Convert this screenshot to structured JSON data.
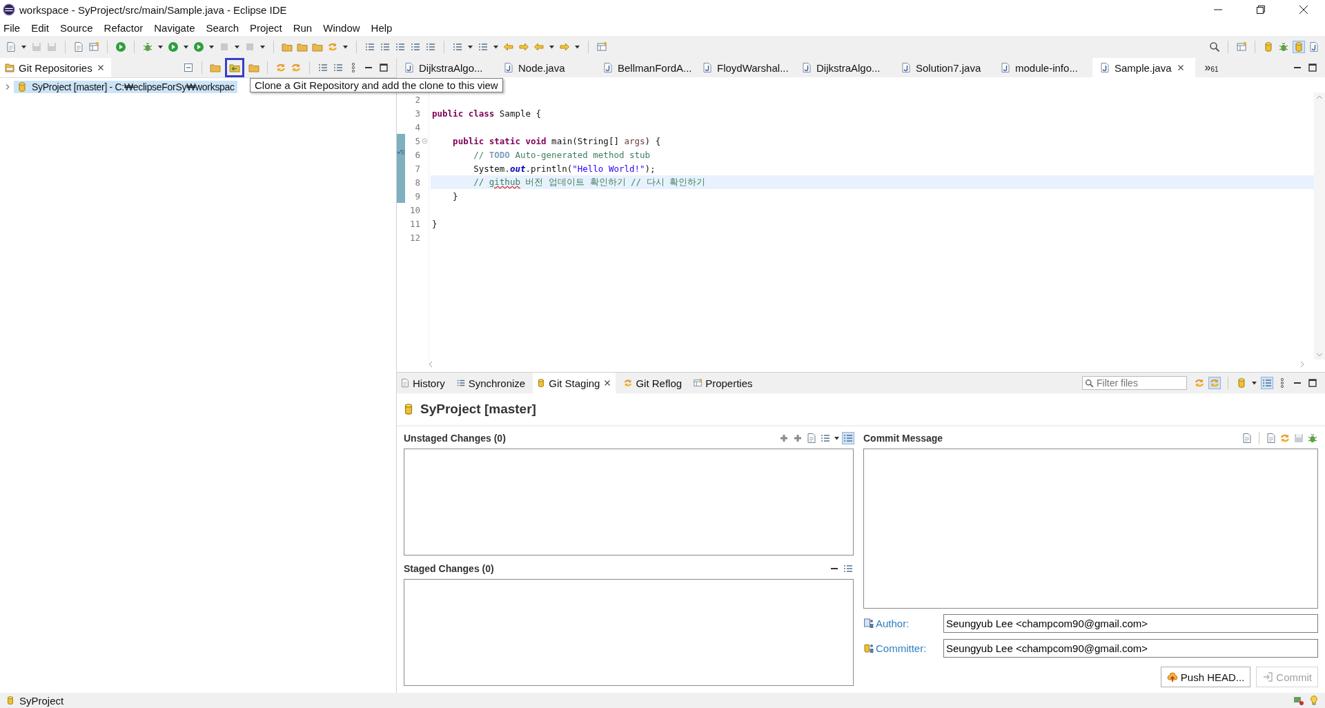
{
  "window": {
    "title": "workspace - SyProject/src/main/Sample.java - Eclipse IDE"
  },
  "menu": [
    "File",
    "Edit",
    "Source",
    "Refactor",
    "Navigate",
    "Search",
    "Project",
    "Run",
    "Window",
    "Help"
  ],
  "git_repositories": {
    "title": "Git Repositories",
    "tree": [
      {
        "label": "SyProject [master] - C:₩eclipseForSy₩workspac",
        "expanded": false,
        "selected": true
      }
    ],
    "tooltip": {
      "text": "Clone a Git Repository and add the clone to this view",
      "anchor_marked": true
    }
  },
  "editor": {
    "tabs": [
      {
        "label": "DijkstraAlgo...",
        "selected": false
      },
      {
        "label": "Node.java",
        "selected": false
      },
      {
        "label": "BellmanFordA...",
        "selected": false
      },
      {
        "label": "FloydWarshal...",
        "selected": false
      },
      {
        "label": "DijkstraAlgo...",
        "selected": false
      },
      {
        "label": "Solution7.java",
        "selected": false
      },
      {
        "label": "module-info...",
        "selected": false
      },
      {
        "label": "Sample.java",
        "selected": true
      }
    ],
    "overflow": {
      "symbol": "»",
      "count": "61"
    },
    "lines": [
      {
        "number": "2",
        "highlighted": false,
        "changed": false,
        "fold": false,
        "task": false
      },
      {
        "number": "3",
        "highlighted": false,
        "changed": false,
        "fold": false,
        "task": false,
        "tokens": [
          {
            "kind": "keyword",
            "text": "public class"
          },
          {
            "kind": "plain",
            "text": " Sample {"
          }
        ]
      },
      {
        "number": "4",
        "highlighted": false,
        "changed": false,
        "fold": false,
        "task": false
      },
      {
        "number": "5",
        "highlighted": false,
        "changed": true,
        "fold": true,
        "task": false,
        "tokens": [
          {
            "kind": "keyword",
            "text": "    public static void"
          },
          {
            "kind": "plain",
            "text": " main(String[] "
          },
          {
            "kind": "param",
            "text": "args"
          },
          {
            "kind": "plain",
            "text": ") {"
          }
        ]
      },
      {
        "number": "6",
        "highlighted": false,
        "changed": true,
        "fold": false,
        "task": true,
        "tokens": [
          {
            "kind": "comment",
            "text": "        // "
          },
          {
            "kind": "todo",
            "text": "TODO"
          },
          {
            "kind": "comment",
            "text": " Auto-generated method stub"
          }
        ]
      },
      {
        "number": "7",
        "highlighted": false,
        "changed": true,
        "fold": false,
        "task": false,
        "tokens": [
          {
            "kind": "plain",
            "text": "        System."
          },
          {
            "kind": "field",
            "text": "out"
          },
          {
            "kind": "plain",
            "text": ".println("
          },
          {
            "kind": "string",
            "text": "\"Hello World!\""
          },
          {
            "kind": "plain",
            "text": ");"
          }
        ]
      },
      {
        "number": "8",
        "highlighted": true,
        "changed": true,
        "fold": false,
        "task": false,
        "tokens": [
          {
            "kind": "comment",
            "text": "        // "
          },
          {
            "kind": "misspelled",
            "text": "github"
          },
          {
            "kind": "comment",
            "text": " 버전 업데이트 확인하기 // 다시 확인하기"
          }
        ]
      },
      {
        "number": "9",
        "highlighted": false,
        "changed": true,
        "fold": false,
        "task": false,
        "tokens": [
          {
            "kind": "plain",
            "text": "    }"
          }
        ]
      },
      {
        "number": "10",
        "highlighted": false,
        "changed": false,
        "fold": false,
        "task": false
      },
      {
        "number": "11",
        "highlighted": false,
        "changed": false,
        "fold": false,
        "task": false,
        "tokens": [
          {
            "kind": "plain",
            "text": "}"
          }
        ]
      },
      {
        "number": "12",
        "highlighted": false,
        "changed": false,
        "fold": false,
        "task": false
      }
    ]
  },
  "bottom_panel": {
    "tabs": [
      {
        "label": "History",
        "selected": false
      },
      {
        "label": "Synchronize",
        "selected": false
      },
      {
        "label": "Git Staging",
        "selected": true
      },
      {
        "label": "Git Reflog",
        "selected": false
      },
      {
        "label": "Properties",
        "selected": false
      }
    ],
    "filter": {
      "placeholder": "Filter files"
    },
    "repository": "SyProject [master]",
    "unstaged": {
      "title": "Unstaged Changes (0)"
    },
    "staged": {
      "title": "Staged Changes (0)"
    },
    "commit_message": {
      "title": "Commit Message"
    },
    "author": {
      "label": "Author:",
      "value": "Seungyub Lee <champcom90@gmail.com>"
    },
    "committer": {
      "label": "Committer:",
      "value": "Seungyub Lee <champcom90@gmail.com>"
    },
    "buttons": [
      {
        "kind": "push",
        "label": "Push HEAD...",
        "disabled": false
      },
      {
        "kind": "commit",
        "label": "Commit",
        "disabled": true
      }
    ]
  },
  "status_bar": {
    "text": "SyProject"
  }
}
